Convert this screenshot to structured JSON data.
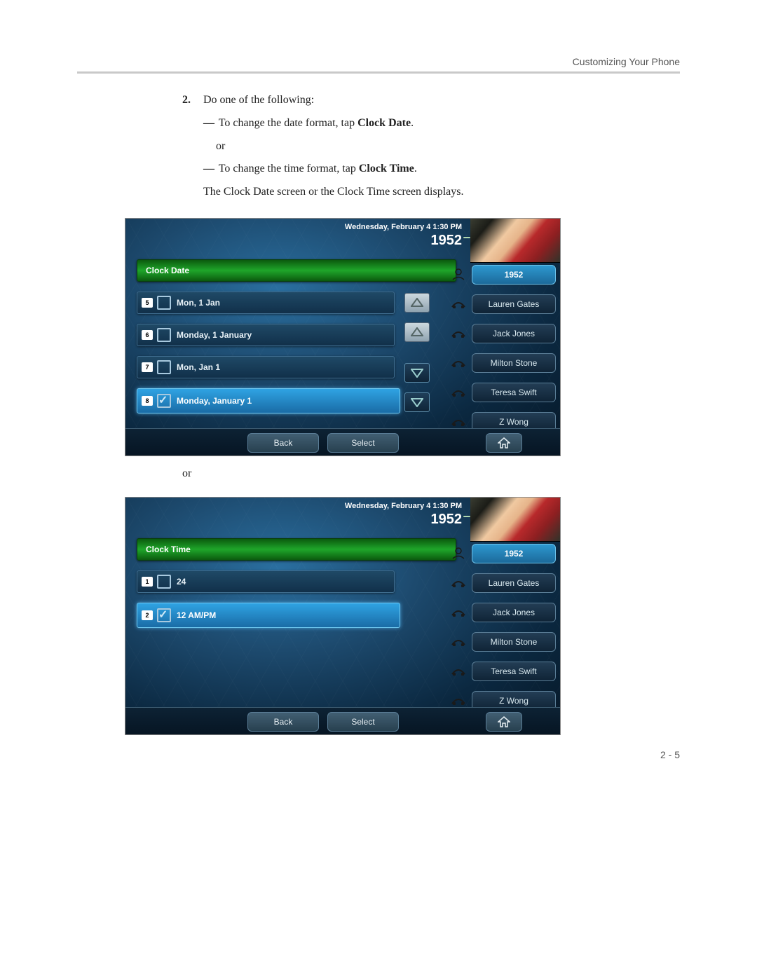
{
  "header": {
    "running": "Customizing Your Phone"
  },
  "step": {
    "number": "2.",
    "intro": "Do one of the following:",
    "bullet1_a": "To change the date format, tap ",
    "bullet1_b": "Clock Date",
    "bullet1_c": ".",
    "or": "or",
    "bullet2_a": "To change the time format, tap ",
    "bullet2_b": "Clock Time",
    "bullet2_c": ".",
    "result": "The Clock Date screen or the Clock Time screen displays."
  },
  "screens": {
    "common": {
      "datetime": "Wednesday, February 4  1:30 PM",
      "extension": "1952",
      "back": "Back",
      "select": "Select",
      "contacts": [
        {
          "label": "1952",
          "icon": "person",
          "active": true
        },
        {
          "label": "Lauren Gates",
          "icon": "dial",
          "active": false
        },
        {
          "label": "Jack Jones",
          "icon": "dial",
          "active": false
        },
        {
          "label": "Milton Stone",
          "icon": "dial",
          "active": false
        },
        {
          "label": "Teresa Swift",
          "icon": "dial",
          "active": false
        },
        {
          "label": "Z Wong",
          "icon": "dial",
          "active": false
        }
      ]
    },
    "date": {
      "title": "Clock Date",
      "arrows": true,
      "options": [
        {
          "num": "5",
          "label": "Mon, 1 Jan",
          "checked": false
        },
        {
          "num": "6",
          "label": "Monday, 1 January",
          "checked": false
        },
        {
          "num": "7",
          "label": "Mon, Jan 1",
          "checked": false
        },
        {
          "num": "8",
          "label": "Monday, January 1",
          "checked": true
        }
      ]
    },
    "time": {
      "title": "Clock Time",
      "arrows": false,
      "options": [
        {
          "num": "1",
          "label": "24",
          "checked": false
        },
        {
          "num": "2",
          "label": "12 AM/PM",
          "checked": true
        }
      ]
    }
  },
  "between": "or",
  "footer": {
    "page": "2 - 5"
  }
}
